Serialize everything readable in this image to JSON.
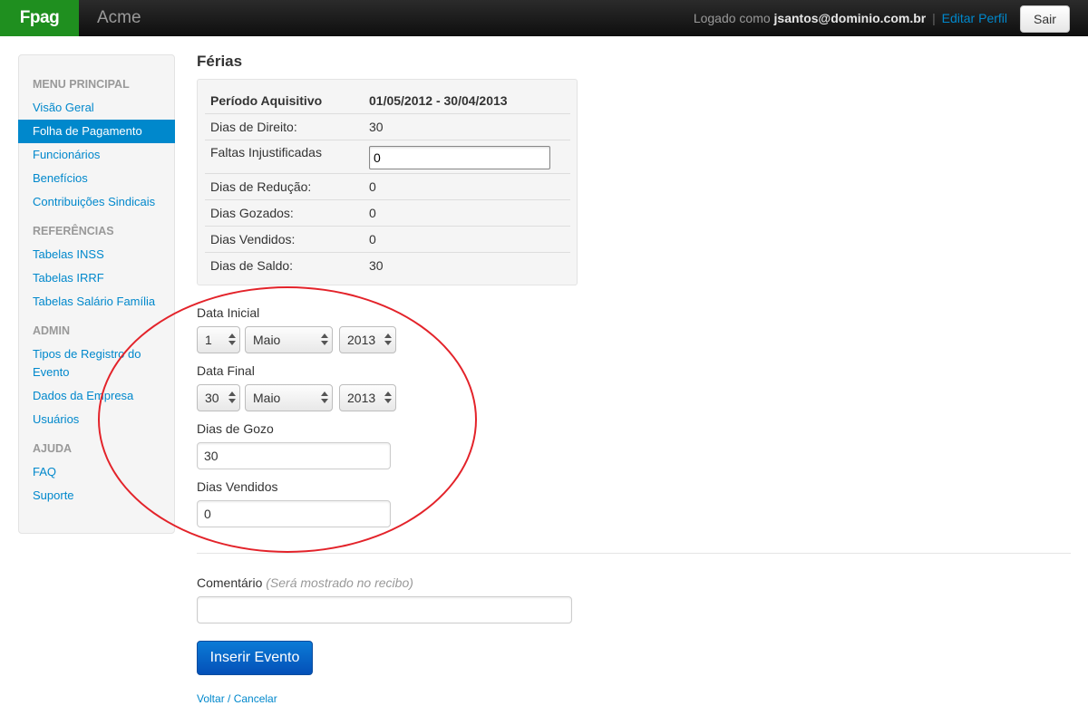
{
  "topbar": {
    "brand": "Fpag",
    "company": "Acme",
    "logged_as_prefix": "Logado como",
    "user_email": "jsantos@dominio.com.br",
    "separator": "|",
    "edit_profile": "Editar Perfil",
    "logout": "Sair"
  },
  "sidebar": {
    "sections": [
      {
        "header": "MENU PRINCIPAL",
        "items": [
          "Visão Geral",
          "Folha de Pagamento",
          "Funcionários",
          "Benefícios",
          "Contribuições Sindicais"
        ]
      },
      {
        "header": "REFERÊNCIAS",
        "items": [
          "Tabelas INSS",
          "Tabelas IRRF",
          "Tabelas Salário Família"
        ]
      },
      {
        "header": "ADMIN",
        "items": [
          "Tipos de Registro do Evento",
          "Dados da Empresa",
          "Usuários"
        ]
      },
      {
        "header": "AJUDA",
        "items": [
          "FAQ",
          "Suporte"
        ]
      }
    ],
    "active_item": "Folha de Pagamento"
  },
  "main": {
    "title": "Férias",
    "summary": {
      "rows": [
        {
          "label": "Período Aquisitivo",
          "value": "01/05/2012 - 30/04/2013"
        },
        {
          "label": "Dias de Direito:",
          "value": "30"
        },
        {
          "label": "Faltas Injustificadas",
          "value": "0"
        },
        {
          "label": "Dias de Redução:",
          "value": "0"
        },
        {
          "label": "Dias Gozados:",
          "value": "0"
        },
        {
          "label": "Dias Vendidos:",
          "value": "0"
        },
        {
          "label": "Dias de Saldo:",
          "value": "30"
        }
      ]
    },
    "data_inicial": {
      "label": "Data Inicial",
      "day": "1",
      "month": "Maio",
      "year": "2013"
    },
    "data_final": {
      "label": "Data Final",
      "day": "30",
      "month": "Maio",
      "year": "2013"
    },
    "dias_gozo": {
      "label": "Dias de Gozo",
      "value": "30"
    },
    "dias_vendidos": {
      "label": "Dias Vendidos",
      "value": "0"
    },
    "comentario": {
      "label": "Comentário",
      "hint": "(Será mostrado no recibo)",
      "value": ""
    },
    "submit_label": "Inserir Evento",
    "cancel_label": "Voltar / Cancelar"
  },
  "colors": {
    "brand_bg": "#1f8f1f",
    "link": "#0088cc",
    "active_nav_bg": "#0088cc",
    "primary_button": "#0450b8",
    "annotation_circle": "#e3232a"
  }
}
